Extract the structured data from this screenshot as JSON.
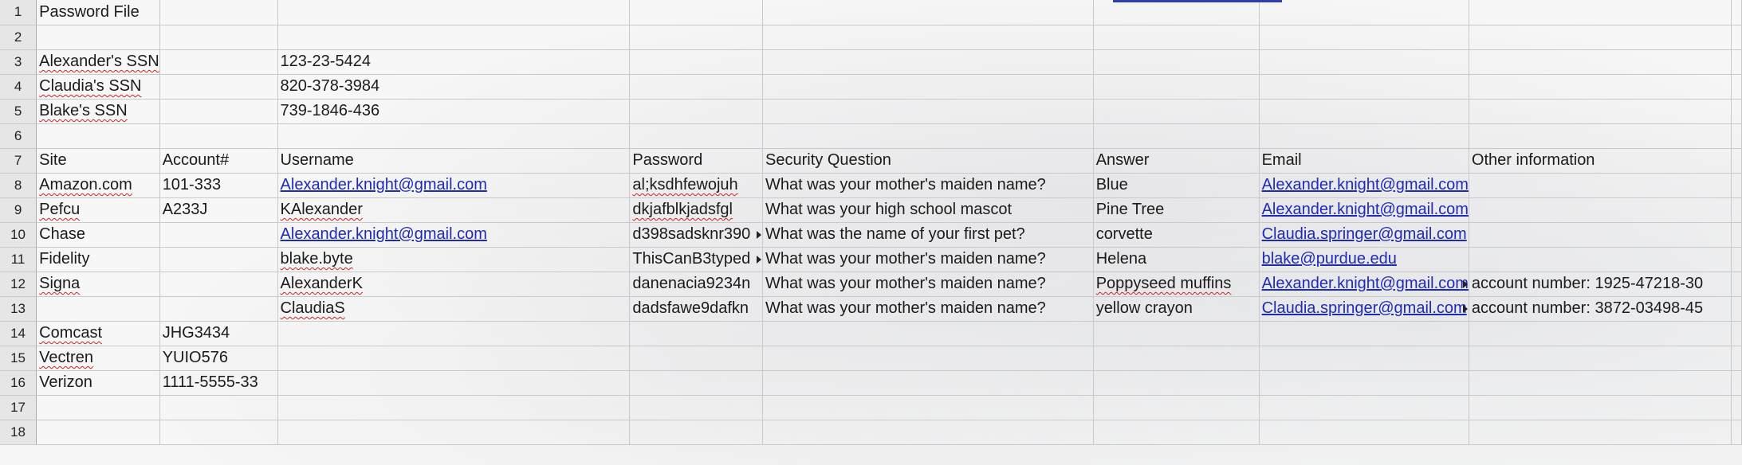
{
  "sheet": {
    "rows": [
      {
        "n": "1",
        "cells": [
          {
            "t": "Password File"
          },
          {
            "t": ""
          },
          {
            "t": ""
          },
          {
            "t": ""
          },
          {
            "t": ""
          },
          {
            "t": ""
          },
          {
            "t": ""
          },
          {
            "t": ""
          },
          {
            "t": ""
          }
        ]
      },
      {
        "n": "2",
        "cells": [
          {
            "t": ""
          },
          {
            "t": ""
          },
          {
            "t": ""
          },
          {
            "t": ""
          },
          {
            "t": ""
          },
          {
            "t": ""
          },
          {
            "t": ""
          },
          {
            "t": ""
          },
          {
            "t": ""
          }
        ]
      },
      {
        "n": "3",
        "cells": [
          {
            "t": "Alexander's SSN",
            "s": 1
          },
          {
            "t": ""
          },
          {
            "t": "123-23-5424"
          },
          {
            "t": ""
          },
          {
            "t": ""
          },
          {
            "t": ""
          },
          {
            "t": ""
          },
          {
            "t": ""
          },
          {
            "t": ""
          }
        ]
      },
      {
        "n": "4",
        "cells": [
          {
            "t": "Claudia's SSN",
            "s": 1
          },
          {
            "t": ""
          },
          {
            "t": "820-378-3984"
          },
          {
            "t": ""
          },
          {
            "t": ""
          },
          {
            "t": ""
          },
          {
            "t": ""
          },
          {
            "t": ""
          },
          {
            "t": ""
          }
        ]
      },
      {
        "n": "5",
        "cells": [
          {
            "t": "Blake's SSN",
            "s": 1
          },
          {
            "t": ""
          },
          {
            "t": "739-1846-436"
          },
          {
            "t": ""
          },
          {
            "t": ""
          },
          {
            "t": ""
          },
          {
            "t": ""
          },
          {
            "t": ""
          },
          {
            "t": ""
          }
        ]
      },
      {
        "n": "6",
        "cells": [
          {
            "t": ""
          },
          {
            "t": ""
          },
          {
            "t": ""
          },
          {
            "t": ""
          },
          {
            "t": ""
          },
          {
            "t": ""
          },
          {
            "t": ""
          },
          {
            "t": ""
          },
          {
            "t": ""
          }
        ]
      },
      {
        "n": "7",
        "cells": [
          {
            "t": "Site"
          },
          {
            "t": "Account#"
          },
          {
            "t": "Username"
          },
          {
            "t": "Password"
          },
          {
            "t": "Security Question"
          },
          {
            "t": "Answer"
          },
          {
            "t": "Email"
          },
          {
            "t": "Other information"
          },
          {
            "t": ""
          }
        ]
      },
      {
        "n": "8",
        "cells": [
          {
            "t": "Amazon.com",
            "s": 1
          },
          {
            "t": "101-333"
          },
          {
            "t": "Alexander.knight@gmail.com",
            "l": 1
          },
          {
            "t": "al;ksdhfewojuh",
            "s": 1
          },
          {
            "t": "What was your mother's maiden name?"
          },
          {
            "t": "Blue"
          },
          {
            "t": "Alexander.knight@gmail.com",
            "l": 1
          },
          {
            "t": ""
          },
          {
            "t": ""
          }
        ]
      },
      {
        "n": "9",
        "cells": [
          {
            "t": "Pefcu",
            "s": 1
          },
          {
            "t": "A233J"
          },
          {
            "t": "KAlexander",
            "s": 1
          },
          {
            "t": "dkjafblkjadsfgl",
            "s": 1
          },
          {
            "t": "What was your high school mascot"
          },
          {
            "t": "Pine Tree"
          },
          {
            "t": "Alexander.knight@gmail.com",
            "l": 1
          },
          {
            "t": ""
          },
          {
            "t": ""
          }
        ]
      },
      {
        "n": "10",
        "cells": [
          {
            "t": "Chase"
          },
          {
            "t": ""
          },
          {
            "t": "Alexander.knight@gmail.com",
            "l": 1
          },
          {
            "t": "d398sadsknr390",
            "o": 1
          },
          {
            "t": "What was the name of your first pet?"
          },
          {
            "t": "corvette"
          },
          {
            "t": "Claudia.springer@gmail.com",
            "l": 1
          },
          {
            "t": ""
          },
          {
            "t": ""
          }
        ]
      },
      {
        "n": "11",
        "cells": [
          {
            "t": "Fidelity"
          },
          {
            "t": ""
          },
          {
            "t": "blake.byte",
            "s": 1
          },
          {
            "t": "ThisCanB3typed",
            "o": 1
          },
          {
            "t": "What was your mother's maiden name?"
          },
          {
            "t": "Helena"
          },
          {
            "t": "blake@purdue.edu",
            "l": 1
          },
          {
            "t": ""
          },
          {
            "t": ""
          }
        ]
      },
      {
        "n": "12",
        "cells": [
          {
            "t": "Signa",
            "s": 1
          },
          {
            "t": ""
          },
          {
            "t": "AlexanderK",
            "s": 1
          },
          {
            "t": "danenacia9234n"
          },
          {
            "t": "What was your mother's maiden name?"
          },
          {
            "t": "Poppyseed muffins",
            "s": 1
          },
          {
            "t": "Alexander.knight@gmail.com",
            "l": 1,
            "o": 1
          },
          {
            "t": "account number: 1925-47218-30"
          },
          {
            "t": ""
          }
        ]
      },
      {
        "n": "13",
        "cells": [
          {
            "t": ""
          },
          {
            "t": ""
          },
          {
            "t": "ClaudiaS",
            "s": 1
          },
          {
            "t": "dadsfawe9dafkn"
          },
          {
            "t": "What was your mother's maiden name?"
          },
          {
            "t": "yellow crayon"
          },
          {
            "t": "Claudia.springer@gmail.com",
            "l": 1,
            "o": 1
          },
          {
            "t": "account number: 3872-03498-45"
          },
          {
            "t": ""
          }
        ]
      },
      {
        "n": "14",
        "cells": [
          {
            "t": "Comcast",
            "s": 1
          },
          {
            "t": "JHG3434"
          },
          {
            "t": ""
          },
          {
            "t": ""
          },
          {
            "t": ""
          },
          {
            "t": ""
          },
          {
            "t": ""
          },
          {
            "t": ""
          },
          {
            "t": ""
          }
        ]
      },
      {
        "n": "15",
        "cells": [
          {
            "t": "Vectren",
            "s": 1
          },
          {
            "t": "YUIO576"
          },
          {
            "t": ""
          },
          {
            "t": ""
          },
          {
            "t": ""
          },
          {
            "t": ""
          },
          {
            "t": ""
          },
          {
            "t": ""
          },
          {
            "t": ""
          }
        ]
      },
      {
        "n": "16",
        "cells": [
          {
            "t": "Verizon"
          },
          {
            "t": "1111-5555-33"
          },
          {
            "t": ""
          },
          {
            "t": ""
          },
          {
            "t": ""
          },
          {
            "t": ""
          },
          {
            "t": ""
          },
          {
            "t": ""
          },
          {
            "t": ""
          }
        ]
      },
      {
        "n": "17",
        "cells": [
          {
            "t": ""
          },
          {
            "t": ""
          },
          {
            "t": ""
          },
          {
            "t": ""
          },
          {
            "t": ""
          },
          {
            "t": ""
          },
          {
            "t": ""
          },
          {
            "t": ""
          },
          {
            "t": ""
          }
        ]
      },
      {
        "n": "18",
        "cells": [
          {
            "t": ""
          },
          {
            "t": ""
          },
          {
            "t": ""
          },
          {
            "t": ""
          },
          {
            "t": ""
          },
          {
            "t": ""
          },
          {
            "t": ""
          },
          {
            "t": ""
          },
          {
            "t": ""
          }
        ]
      }
    ]
  },
  "colors": {
    "link": "#1f2bb5",
    "grid": "#c9c9c9",
    "row_header_bg": "#e6e6e6",
    "selection": "#2b3fb0",
    "spellcheck": "#cc2222"
  }
}
